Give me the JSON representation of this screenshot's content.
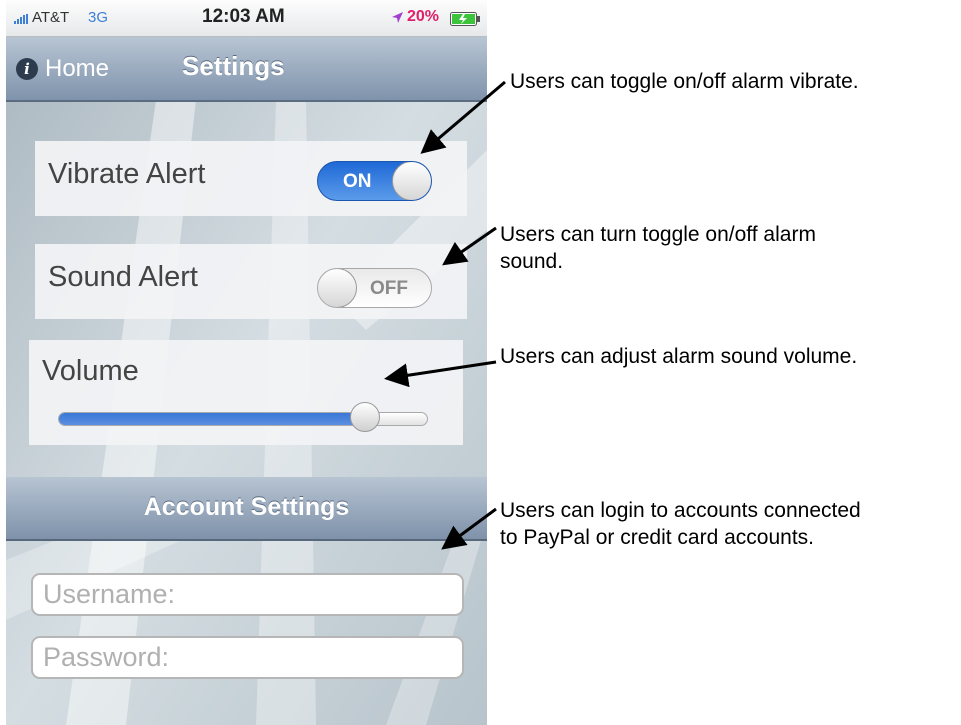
{
  "status_bar": {
    "carrier": "AT&T",
    "network": "3G",
    "time": "12:03 AM",
    "battery_percent": "20%",
    "icons": [
      "signal-bars-icon",
      "location-arrow-icon",
      "battery-charging-icon"
    ]
  },
  "nav": {
    "back_label": "Home",
    "title": "Settings",
    "info_glyph": "i"
  },
  "settings": {
    "vibrate": {
      "label": "Vibrate Alert",
      "toggle_text": "ON",
      "on": true
    },
    "sound": {
      "label": "Sound Alert",
      "toggle_text": "OFF",
      "on": false
    },
    "volume": {
      "label": "Volume",
      "level": 0.83
    }
  },
  "account": {
    "section_title": "Account Settings",
    "username_placeholder": "Username:",
    "password_placeholder": "Password:"
  },
  "annotations": {
    "vibrate": "Users can toggle on/off alarm vibrate.",
    "sound_line1": "Users can turn toggle on/off alarm",
    "sound_line2": "sound.",
    "volume": "Users can adjust alarm sound volume.",
    "account_line1": "Users can login to accounts connected",
    "account_line2": "to PayPal or credit card accounts."
  },
  "colors": {
    "toggle_on": "#1f69d6",
    "nav_bar": "#8ea0b6",
    "battery_text": "#e0206a",
    "network_text": "#3d7fd6"
  }
}
